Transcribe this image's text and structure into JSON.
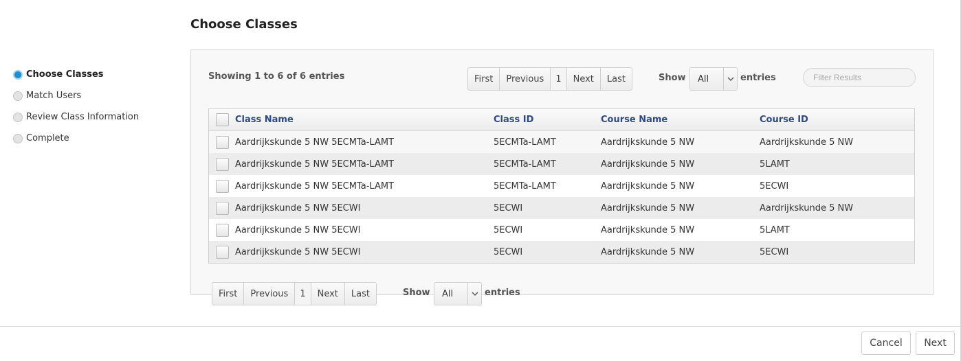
{
  "page": {
    "title": "Choose Classes"
  },
  "steps": [
    {
      "label": "Choose Classes",
      "active": true
    },
    {
      "label": "Match Users",
      "active": false
    },
    {
      "label": "Review Class Information",
      "active": false
    },
    {
      "label": "Complete",
      "active": false
    }
  ],
  "info": {
    "showing": "Showing 1 to 6 of 6 entries"
  },
  "pagination": {
    "first": "First",
    "previous": "Previous",
    "page": "1",
    "next": "Next",
    "last": "Last"
  },
  "length": {
    "show": "Show",
    "value": "All",
    "entries": "entries"
  },
  "filter": {
    "placeholder": "Filter Results"
  },
  "table": {
    "columns": [
      "Class Name",
      "Class ID",
      "Course Name",
      "Course ID"
    ],
    "rows": [
      [
        "Aardrijkskunde 5 NW 5ECMTa-LAMT",
        "5ECMTa-LAMT",
        "Aardrijkskunde 5 NW",
        "Aardrijkskunde 5 NW"
      ],
      [
        "Aardrijkskunde 5 NW 5ECMTa-LAMT",
        "5ECMTa-LAMT",
        "Aardrijkskunde 5 NW",
        "5LAMT"
      ],
      [
        "Aardrijkskunde 5 NW 5ECMTa-LAMT",
        "5ECMTa-LAMT",
        "Aardrijkskunde 5 NW",
        "5ECWI"
      ],
      [
        "Aardrijkskunde 5 NW 5ECWI",
        "5ECWI",
        "Aardrijkskunde 5 NW",
        "Aardrijkskunde 5 NW"
      ],
      [
        "Aardrijkskunde 5 NW 5ECWI",
        "5ECWI",
        "Aardrijkskunde 5 NW",
        "5LAMT"
      ],
      [
        "Aardrijkskunde 5 NW 5ECWI",
        "5ECWI",
        "Aardrijkskunde 5 NW",
        "5ECWI"
      ]
    ]
  },
  "footer": {
    "cancel": "Cancel",
    "next": "Next"
  },
  "colors": {
    "accent": "#1b8fd0",
    "header_text": "#2b4a85"
  },
  "icons": {
    "select_arrow": "chevron-down-icon",
    "step_marker": "radio-dot-icon"
  }
}
